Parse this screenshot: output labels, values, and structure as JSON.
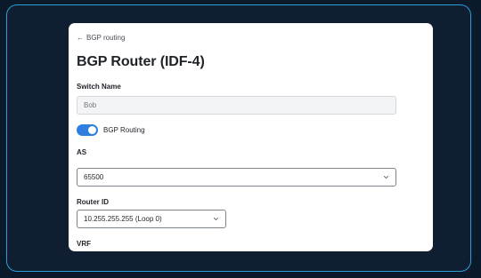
{
  "back_link": {
    "label": "BGP routing"
  },
  "page_title": "BGP Router (IDF-4)",
  "switch_name": {
    "label": "Switch Name",
    "placeholder": "Bob"
  },
  "bgp_routing": {
    "label": "BGP Routing",
    "enabled": true
  },
  "as_field": {
    "label": "AS",
    "value": "65500"
  },
  "router_id": {
    "label": "Router ID",
    "value": "10.255.255.255 (Loop 0)"
  },
  "vrf": {
    "label": "VRF"
  },
  "colors": {
    "accent": "#2f7fe0",
    "frame_border": "#2a9fd6",
    "background": "#0b1a2b"
  },
  "icons": {
    "back": "arrow-left-icon",
    "select": "chevron-down-icon"
  }
}
